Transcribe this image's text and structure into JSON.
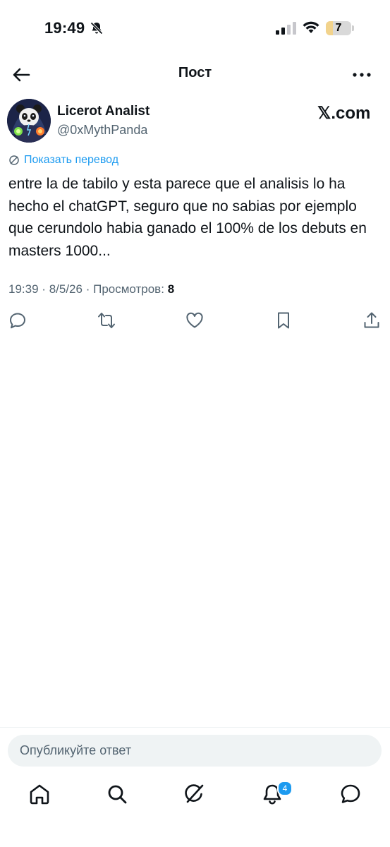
{
  "status_bar": {
    "time": "19:49",
    "battery_level": "7"
  },
  "header": {
    "title": "Пост"
  },
  "author": {
    "name": "Licerot Analist",
    "handle": "@0xMythPanda"
  },
  "source": "𝕏.com",
  "translate_label": "Показать перевод",
  "tweet": {
    "text": "entre la de tabilo y esta parece que el analisis lo ha hecho el chatGPT, seguro que no sabias por ejemplo que cerundolo habia ganado el 100% de los debuts en masters 1000..."
  },
  "meta": {
    "time": "19:39",
    "separator": "·",
    "date": "8/5/26",
    "views_label": "Просмотров:",
    "views_count": "8"
  },
  "reply": {
    "placeholder": "Опубликуйте ответ"
  },
  "tabbar": {
    "notifications_badge": "4"
  },
  "colors": {
    "accent": "#1d9bf0",
    "secondary_text": "#536471",
    "primary_text": "#0f1419"
  },
  "icons": [
    "bell-off-icon",
    "signal-icon",
    "wifi-icon",
    "battery-icon",
    "back-arrow-icon",
    "more-icon",
    "translate-icon",
    "reply-icon",
    "repost-icon",
    "like-icon",
    "bookmark-icon",
    "share-icon",
    "home-icon",
    "search-icon",
    "grok-icon",
    "notifications-icon",
    "messages-icon"
  ]
}
